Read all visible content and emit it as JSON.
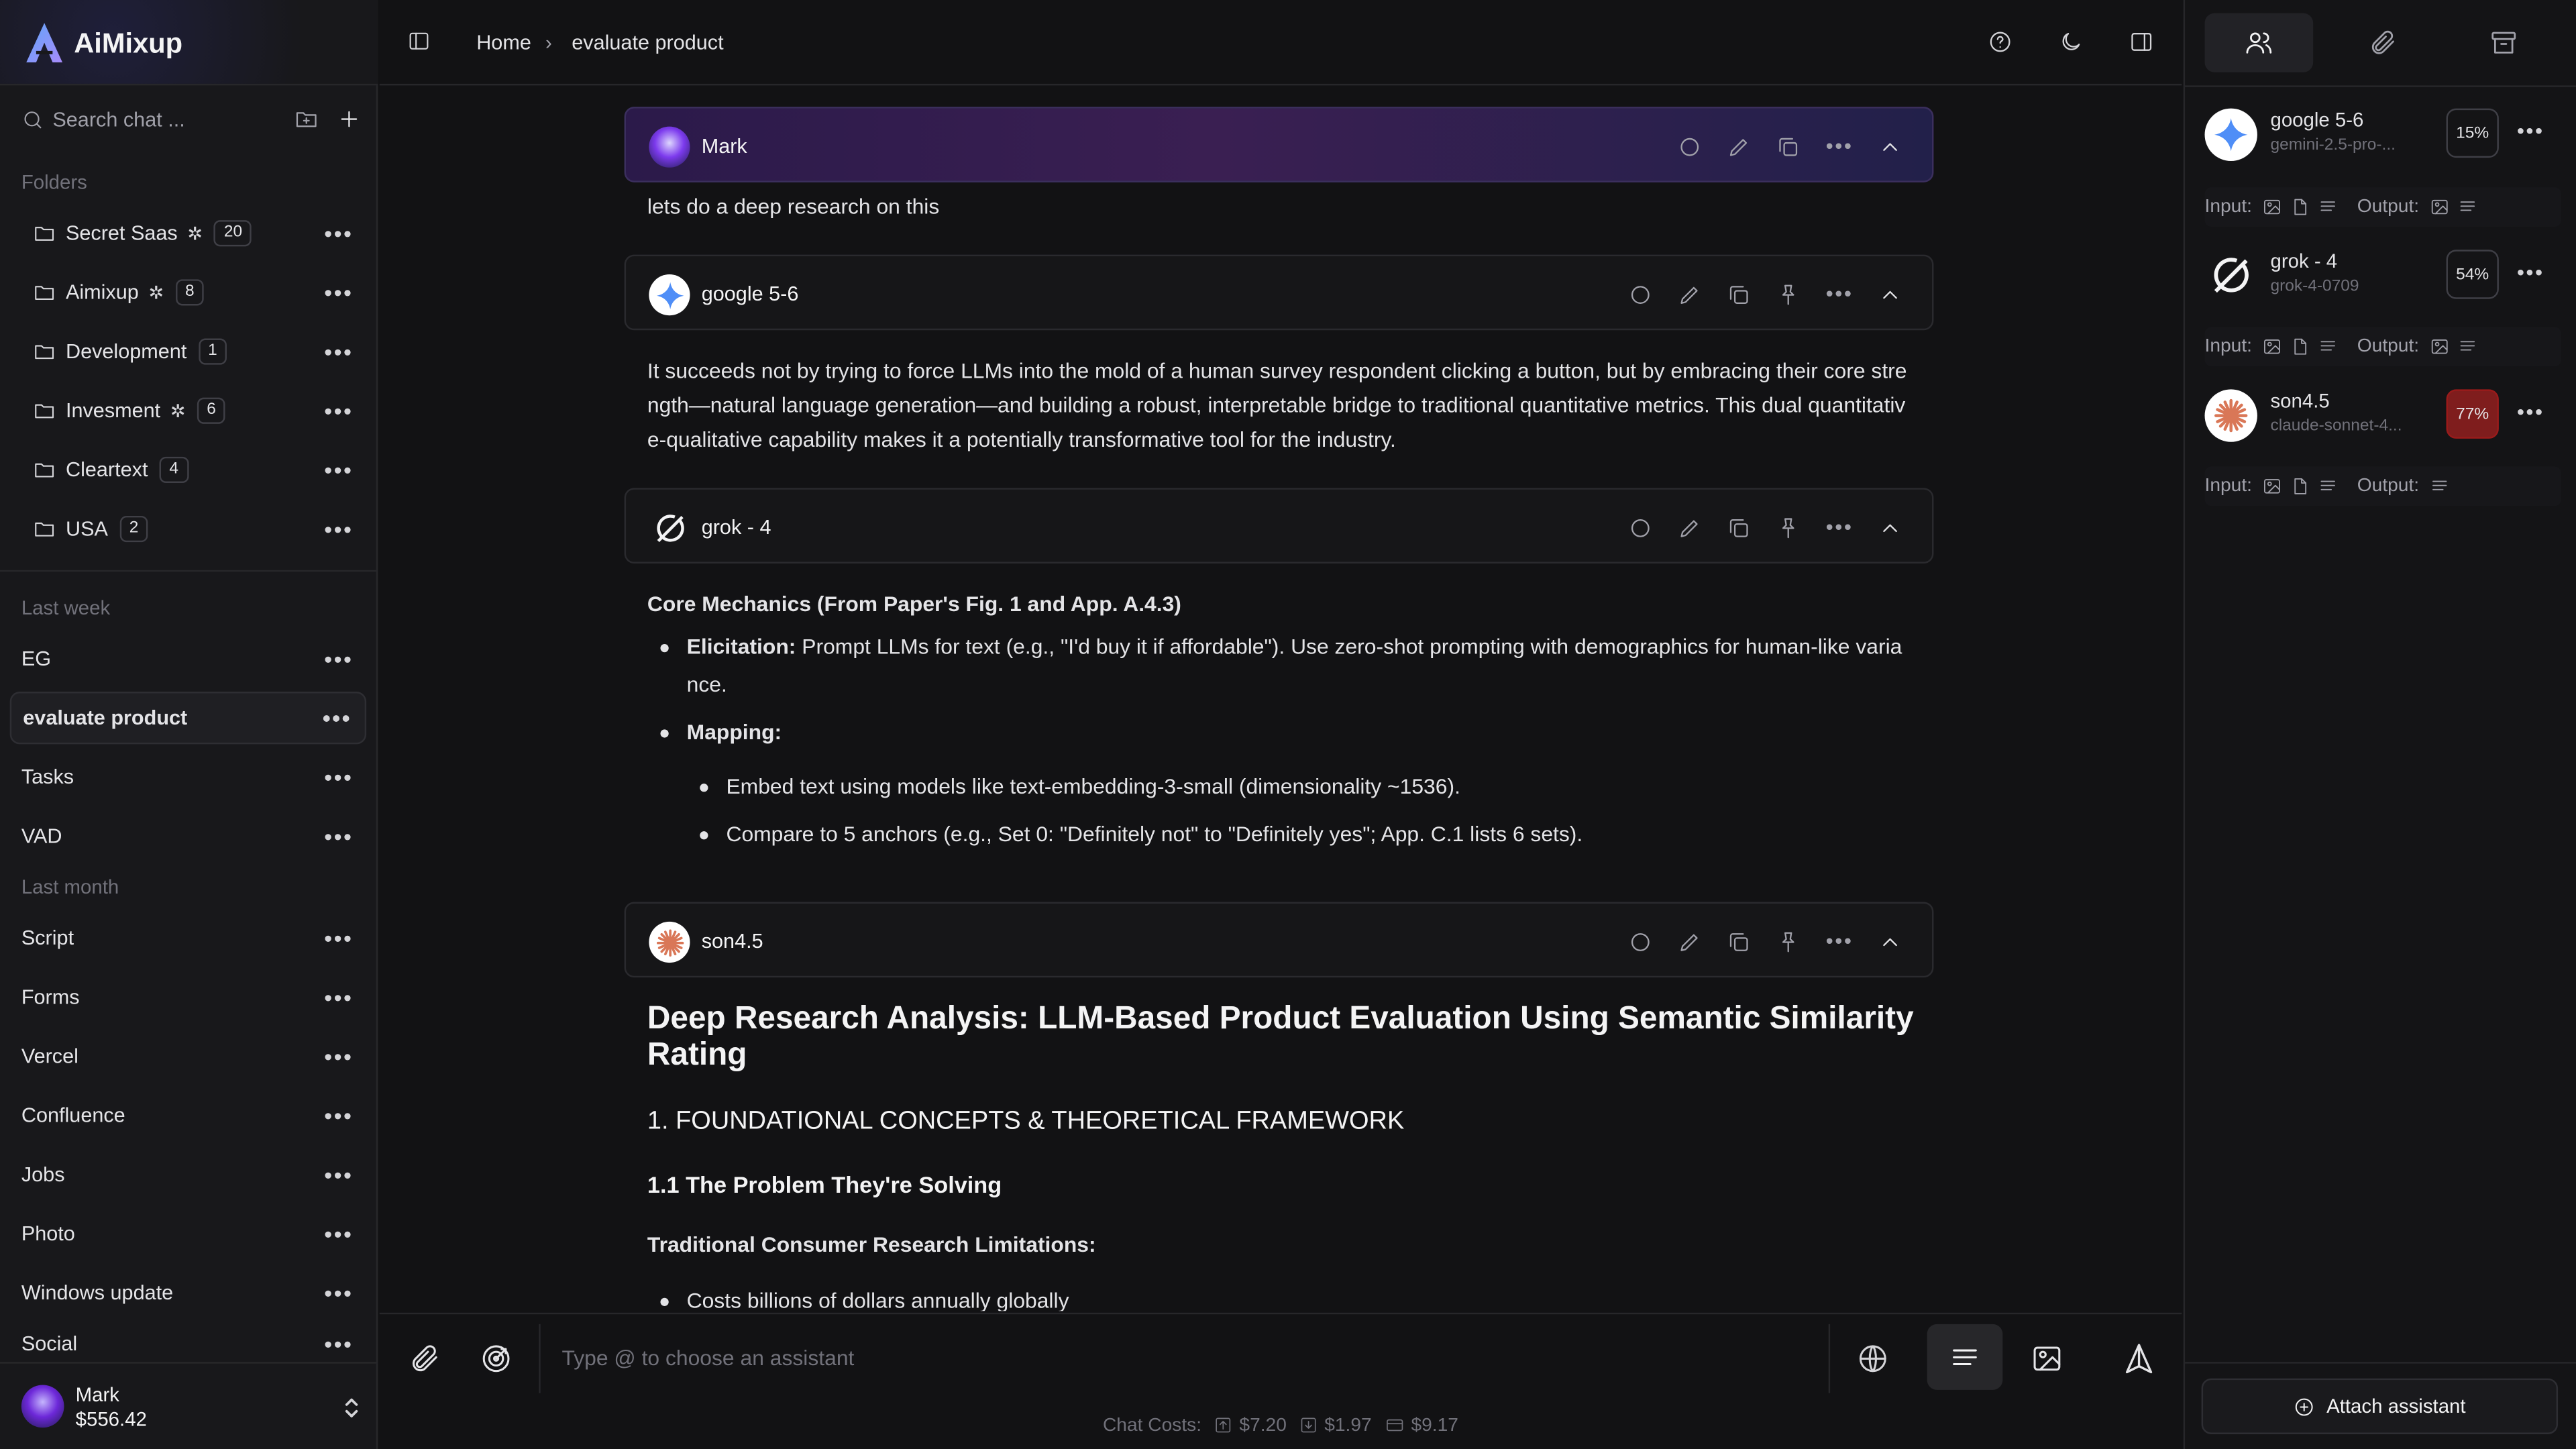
{
  "app": {
    "name": "AiMixup"
  },
  "sidebar": {
    "search_placeholder": "Search chat ...",
    "folders_label": "Folders",
    "folders": [
      {
        "name": "Secret Saas",
        "sparkle": true,
        "count": "20"
      },
      {
        "name": "Aimixup",
        "sparkle": true,
        "count": "8"
      },
      {
        "name": "Development",
        "sparkle": false,
        "count": "1"
      },
      {
        "name": "Invesment",
        "sparkle": true,
        "count": "6"
      },
      {
        "name": "Cleartext",
        "sparkle": false,
        "count": "4"
      },
      {
        "name": "USA",
        "sparkle": false,
        "count": "2"
      }
    ],
    "last_week_label": "Last week",
    "last_week": [
      "EG",
      "evaluate product",
      "Tasks",
      "VAD"
    ],
    "last_month_label": "Last month",
    "last_month": [
      "Script",
      "Forms",
      "Vercel",
      "Confluence",
      "Jobs",
      "Photo",
      "Windows update",
      "Social"
    ],
    "user": {
      "name": "Mark",
      "balance": "$556.42"
    }
  },
  "topbar": {
    "breadcrumb": [
      "Home",
      "evaluate product"
    ]
  },
  "messages": {
    "user": {
      "name": "Mark",
      "text": "lets do a deep research on this"
    },
    "google": {
      "name": "google 5-6",
      "text": "It succeeds not by trying to force LLMs into the mold of a human survey respondent clicking a button, but by embracing their core strength—natural language generation—and building a robust, interpretable bridge to traditional quantitative metrics. This dual quantitative-qualitative capability makes it a potentially transformative tool for the industry."
    },
    "grok": {
      "name": "grok - 4",
      "heading": "Core Mechanics (From Paper's Fig. 1 and App. A.4.3)",
      "elicitation_label": "Elicitation:",
      "elicitation_text": " Prompt LLMs for text (e.g., \"I'd buy it if affordable\"). Use zero-shot prompting with demographics for human-like variance.",
      "mapping_label": "Mapping:",
      "sub": [
        "Embed text using models like text-embedding-3-small (dimensionality ~1536).",
        "Compare to 5 anchors (e.g., Set 0: \"Definitely not\" to \"Definitely yes\"; App. C.1 lists 6 sets)."
      ]
    },
    "son": {
      "name": "son4.5",
      "h1": "Deep Research Analysis: LLM-Based Product Evaluation Using Semantic Similarity Rating",
      "h2": "1. FOUNDATIONAL CONCEPTS & THEORETICAL FRAMEWORK",
      "h3": "1.1 The Problem They're Solving",
      "h4": "Traditional Consumer Research Limitations:",
      "bullet": "Costs billions of dollars annually globally"
    }
  },
  "composer": {
    "placeholder": "Type @ to choose an assistant"
  },
  "costs": {
    "label": "Chat Costs:",
    "input": "$7.20",
    "output": "$1.97",
    "total": "$9.17"
  },
  "right": {
    "assistants": [
      {
        "name": "google 5-6",
        "model": "gemini-2.5-pro-...",
        "pct": "15%"
      },
      {
        "name": "grok - 4",
        "model": "grok-4-0709",
        "pct": "54%"
      },
      {
        "name": "son4.5",
        "model": "claude-sonnet-4...",
        "pct": "77%"
      }
    ],
    "input_label": "Input:",
    "output_label": "Output:",
    "attach": "Attach assistant"
  },
  "colors": {
    "accent_purple": "#3a1f52",
    "danger": "#7f1d1d",
    "gemini": "#4f8ef7",
    "claude": "#d97757"
  }
}
